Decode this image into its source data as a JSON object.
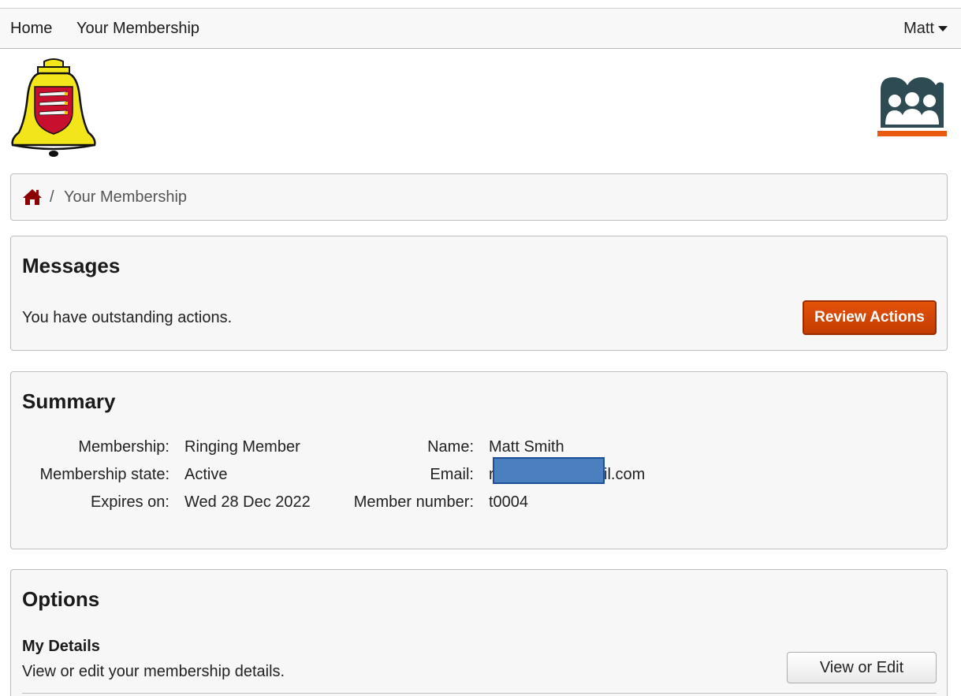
{
  "nav": {
    "home_label": "Home",
    "membership_label": "Your Membership",
    "user_label": "Matt"
  },
  "breadcrumb": {
    "home_icon": "home-icon",
    "separator": "/",
    "current": "Your Membership"
  },
  "messages": {
    "title": "Messages",
    "text": "You have outstanding actions.",
    "button_label": "Review Actions",
    "button_color": "#d4480a"
  },
  "summary": {
    "title": "Summary",
    "membership_label": "Membership:",
    "membership_value": "Ringing Member",
    "state_label": "Membership state:",
    "state_value": "Active",
    "expires_label": "Expires on:",
    "expires_value": "Wed 28 Dec 2022",
    "name_label": "Name:",
    "name_value": "Matt Smith",
    "email_label": "Email:",
    "email_value_start": "r",
    "email_value_end": "il.com",
    "number_label": "Member number:",
    "number_value": "t0004"
  },
  "options": {
    "title": "Options",
    "my_details_heading": "My Details",
    "my_details_desc": "View or edit your membership details.",
    "view_edit_label": "View or Edit"
  },
  "colors": {
    "accent": "#d4480a",
    "redaction": "#4a7fc0",
    "home_icon": "#8b0000",
    "members_logo": "#2e4a52",
    "members_logo_bar": "#e85a10"
  }
}
